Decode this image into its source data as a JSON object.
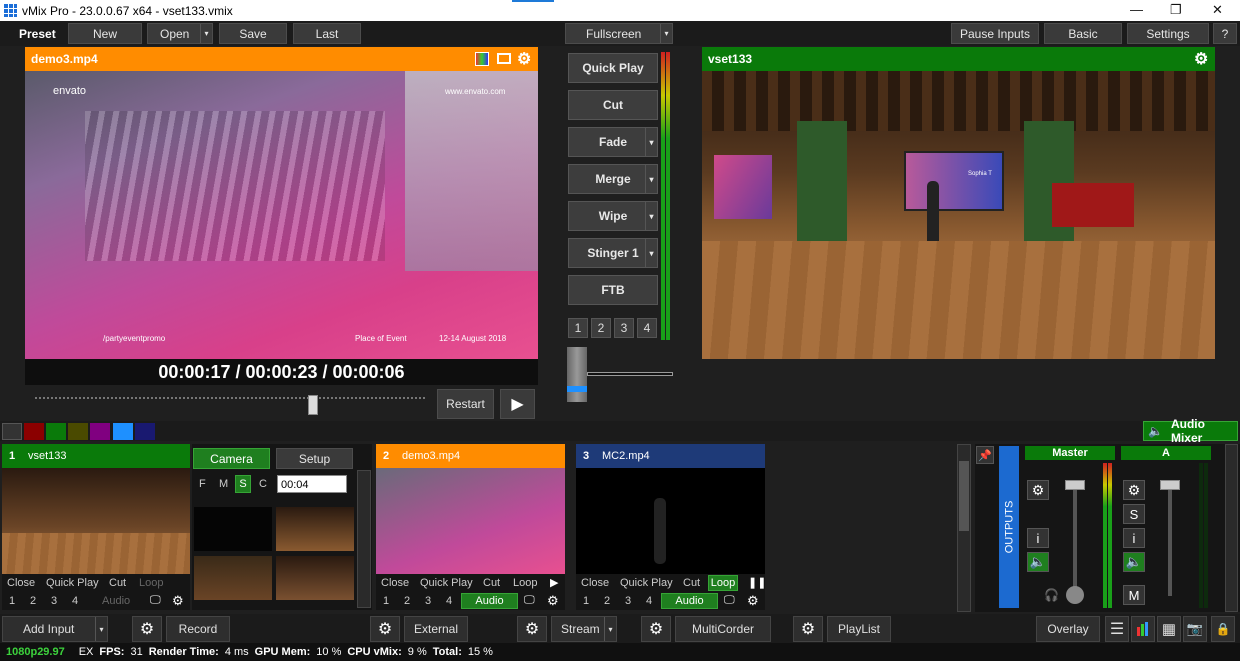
{
  "window": {
    "title": "vMix Pro - 23.0.0.67 x64 - vset133.vmix",
    "minimize": "—",
    "restore": "❐",
    "close": "✕"
  },
  "toolbar": {
    "preset": "Preset",
    "new": "New",
    "open": "Open",
    "save": "Save",
    "last": "Last",
    "fullscreen": "Fullscreen",
    "pause_inputs": "Pause Inputs",
    "basic": "Basic",
    "settings": "Settings",
    "help": "?"
  },
  "preview": {
    "title": "demo3.mp4",
    "timecode": "00:00:17  /  00:00:23  /  00:00:06",
    "restart": "Restart",
    "play": "▶",
    "overlay_logo": "envato",
    "overlay_url": "www.envato.com",
    "overlay_social": "/partyeventpromo",
    "overlay_place": "Place of Event",
    "overlay_date": "12-14 August 2018"
  },
  "transitions": {
    "quick_play": "Quick Play",
    "cut": "Cut",
    "fade": "Fade",
    "merge": "Merge",
    "wipe": "Wipe",
    "stinger": "Stinger 1",
    "ftb": "FTB",
    "numbers": [
      "1",
      "2",
      "3",
      "4"
    ],
    "level_fraction": 0.18
  },
  "output": {
    "title": "vset133",
    "screen_name": "Sophia T"
  },
  "colors": {
    "preset_orange": "#ff8c00",
    "output_green": "#0a7a0a",
    "input_blue": "#1e3a78",
    "accent_green": "#1f7f1f",
    "tabs": [
      "#8b0000",
      "#0a7a0a",
      "#800080",
      "#1e90ff",
      "#191970"
    ]
  },
  "audio_mixer": {
    "label": "Audio Mixer",
    "outputs": "OUTPUTS",
    "master": "Master",
    "a": "A",
    "s": "S",
    "i": "i",
    "m": "M"
  },
  "inputs": [
    {
      "num": "1",
      "name": "vset133",
      "close": "Close",
      "quick_play": "Quick Play",
      "cut": "Cut",
      "loop": "Loop",
      "audio": "Audio",
      "nums": [
        "1",
        "2",
        "3",
        "4"
      ]
    },
    {
      "num": "2",
      "name": "demo3.mp4",
      "close": "Close",
      "quick_play": "Quick Play",
      "cut": "Cut",
      "loop": "Loop",
      "audio": "Audio",
      "nums": [
        "1",
        "2",
        "3",
        "4"
      ]
    },
    {
      "num": "3",
      "name": "MC2.mp4",
      "close": "Close",
      "quick_play": "Quick Play",
      "cut": "Cut",
      "loop": "Loop",
      "audio": "Audio",
      "nums": [
        "1",
        "2",
        "3",
        "4"
      ]
    }
  ],
  "camera_panel": {
    "camera": "Camera",
    "setup": "Setup",
    "f": "F",
    "m": "M",
    "s": "S",
    "c": "C",
    "time": "00:04"
  },
  "bottom": {
    "add_input": "Add Input",
    "record": "Record",
    "external": "External",
    "stream": "Stream",
    "multicorder": "MultiCorder",
    "playlist": "PlayList",
    "overlay": "Overlay"
  },
  "status": {
    "resolution": "1080p29.97",
    "ex": "EX",
    "fps_label": "FPS:",
    "fps": "31",
    "render_label": "Render Time:",
    "render": "4 ms",
    "gpu_label": "GPU Mem:",
    "gpu": "10 %",
    "cpu_label": "CPU vMix:",
    "cpu": "9 %",
    "total_label": "Total:",
    "total": "15 %"
  }
}
